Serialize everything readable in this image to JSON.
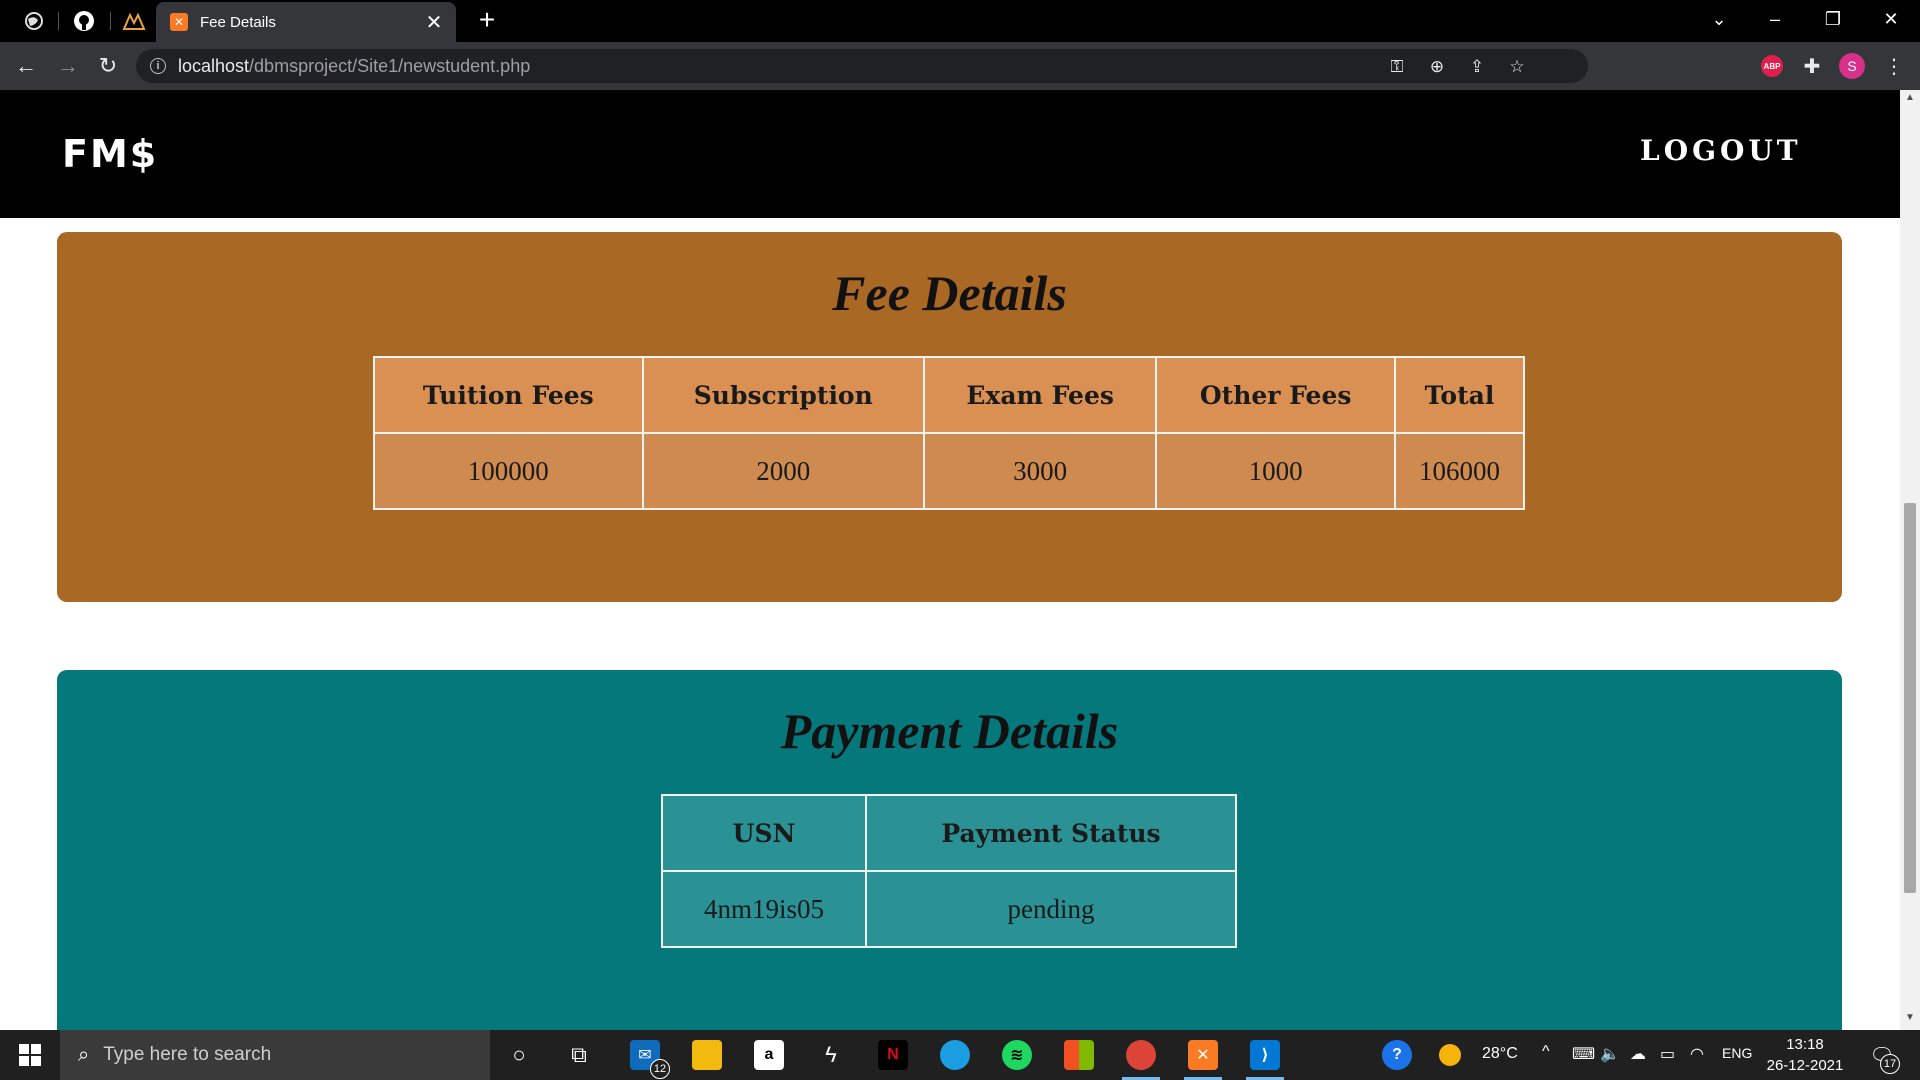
{
  "browser": {
    "tab_title": "Fee Details",
    "tab_favicon": "xampp-icon",
    "url_host": "localhost",
    "url_path": "/dbmsproject/Site1/newstudent.php",
    "profile_initial": "S",
    "adblock_label": "ABP"
  },
  "site": {
    "brand": "FM$",
    "logout_label": "LOGOUT"
  },
  "fee_details": {
    "title": "Fee Details",
    "headers": [
      "Tuition Fees",
      "Subscription",
      "Exam Fees",
      "Other Fees",
      "Total"
    ],
    "values": [
      "100000",
      "2000",
      "3000",
      "1000",
      "106000"
    ]
  },
  "payment_details": {
    "title": "Payment Details",
    "headers": [
      "USN",
      "Payment Status"
    ],
    "values": [
      "4nm19is05",
      "pending"
    ]
  },
  "taskbar": {
    "search_placeholder": "Type here to search",
    "mail_badge": "12",
    "weather": "28°C",
    "language": "ENG",
    "time": "13:18",
    "date": "26-12-2021",
    "notification_count": "17"
  },
  "colors": {
    "fee_card": "#aa6825",
    "payment_card": "#05787c",
    "header": "#000000"
  }
}
